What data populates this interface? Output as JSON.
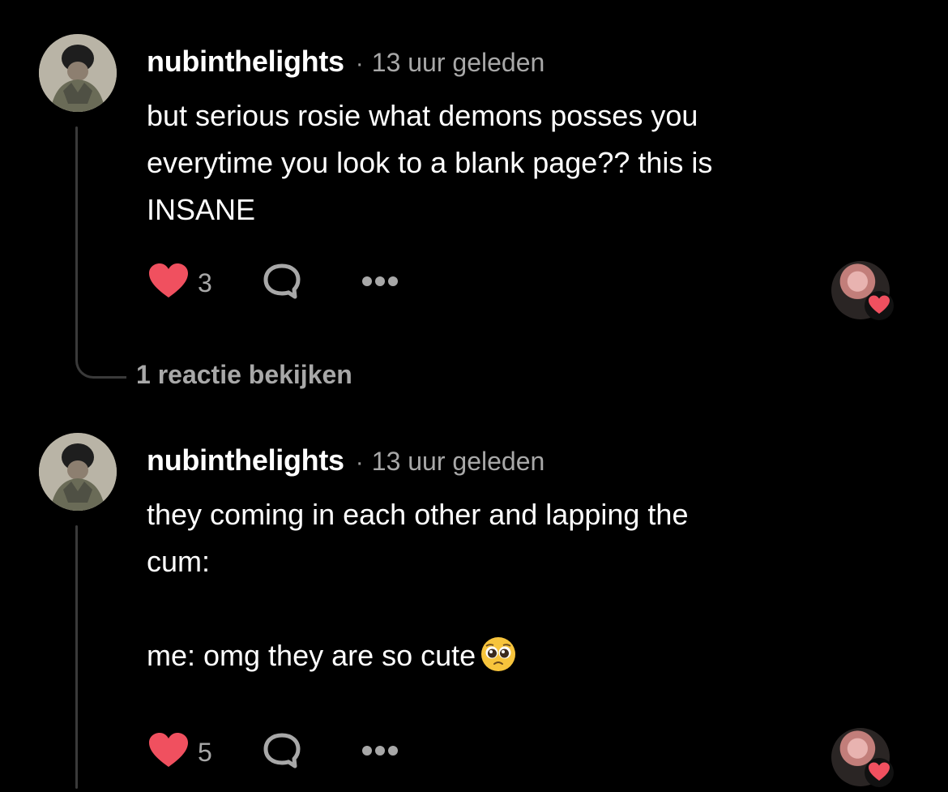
{
  "comments": [
    {
      "username": "nubinthelights",
      "separator": "·",
      "time": "13 uur geleden",
      "text": "but serious rosie what demons posses you\neverytime you look to a blank page?? this is\nINSANE",
      "likes": "3",
      "view_replies": "1 reactie bekijken"
    },
    {
      "username": "nubinthelights",
      "separator": "·",
      "time": "13 uur geleden",
      "text": "they coming in each other and lapping the\ncum:\n\nme: omg they are so cute",
      "emoji": "pleading-face-emoji",
      "likes": "5"
    }
  ],
  "colors": {
    "background": "#000000",
    "text": "#ffffff",
    "muted": "#a8a8a8",
    "heart": "#f0505f",
    "thread": "#3a3a3a"
  },
  "icons": [
    "heart-icon",
    "reply-bubble-icon",
    "more-dots-icon",
    "pleading-face-emoji"
  ]
}
